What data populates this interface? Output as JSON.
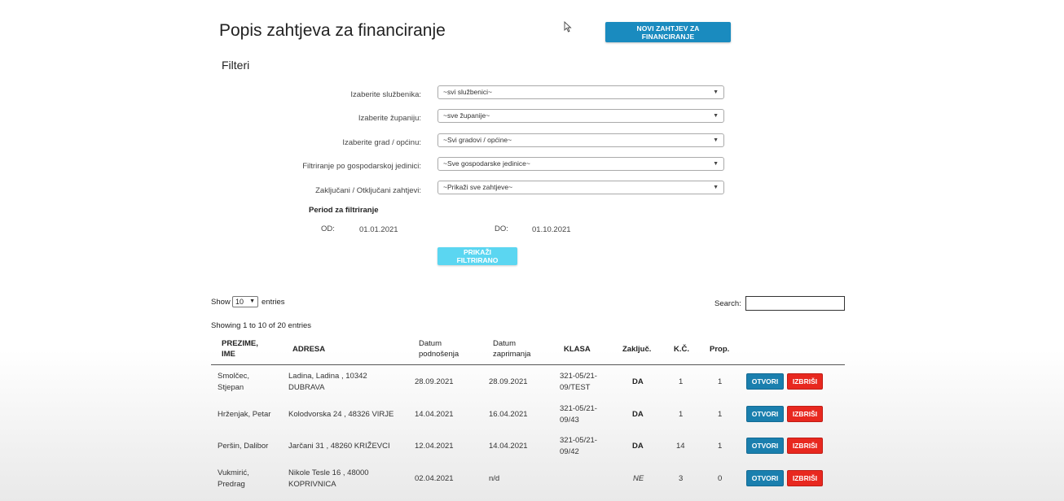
{
  "page": {
    "title": "Popis zahtjeva za financiranje",
    "new_button": "NOVI ZAHTJEV ZA FINANCIRANJE",
    "filters_title": "Filteri"
  },
  "filters": [
    {
      "label": "Izaberite službenika:",
      "value": "~svi službenici~"
    },
    {
      "label": "Izaberite županiju:",
      "value": "~sve županije~"
    },
    {
      "label": "Izaberite grad / općinu:",
      "value": "~Svi gradovi / općine~"
    },
    {
      "label": "Filtriranje po gospodarskoj jedinici:",
      "value": "~Sve gospodarske jedinice~"
    },
    {
      "label": "Zaključani / Otključani zahtjevi:",
      "value": "~Prikaži sve zahtjeve~"
    }
  ],
  "period": {
    "title": "Period za filtriranje",
    "from_label": "OD:",
    "from_value": "01.01.2021",
    "to_label": "DO:",
    "to_value": "01.10.2021"
  },
  "filter_button": "PRIKAŽI FILTRIRANO",
  "datatable": {
    "show_label": "Show",
    "entries_value": "10",
    "entries_label": "entries",
    "search_label": "Search:",
    "info": "Showing 1 to 10 of 20 entries"
  },
  "table": {
    "headers": {
      "name": [
        "PREZIME,",
        "IME"
      ],
      "address": "ADRESA",
      "submitted": [
        "Datum",
        "podnošenja"
      ],
      "received": [
        "Datum",
        "zaprimanja"
      ],
      "klasa": "KLASA",
      "locked": "Zaključ.",
      "kc": "K.Č.",
      "prop": "Prop."
    },
    "open_label": "OTVORI",
    "delete_label": "IZBRIŠI",
    "rows": [
      {
        "name": [
          "Smolčec,",
          "Stjepan"
        ],
        "address": [
          "Ladina, Ladina , 10342",
          "DUBRAVA"
        ],
        "submitted": "28.09.2021",
        "received": "28.09.2021",
        "klasa": [
          "321-05/21-",
          "09/TEST"
        ],
        "locked": "DA",
        "kc": "1",
        "prop": "1"
      },
      {
        "name": [
          "Hrženjak, Petar"
        ],
        "address": [
          "Kolodvorska 24 , 48326 VIRJE"
        ],
        "submitted": "14.04.2021",
        "received": "16.04.2021",
        "klasa": [
          "321-05/21-",
          "09/43"
        ],
        "locked": "DA",
        "kc": "1",
        "prop": "1"
      },
      {
        "name": [
          "Peršin, Dalibor"
        ],
        "address": [
          "Jarčani 31 , 48260 KRIŽEVCI"
        ],
        "submitted": "12.04.2021",
        "received": "14.04.2021",
        "klasa": [
          "321-05/21-",
          "09/42"
        ],
        "locked": "DA",
        "kc": "14",
        "prop": "1"
      },
      {
        "name": [
          "Vukmirić,",
          "Predrag"
        ],
        "address": [
          "Nikole Tesle 16 , 48000",
          "KOPRIVNICA"
        ],
        "submitted": "02.04.2021",
        "received": "n/d",
        "klasa": [
          ""
        ],
        "locked": "NE",
        "kc": "3",
        "prop": "0"
      }
    ]
  }
}
